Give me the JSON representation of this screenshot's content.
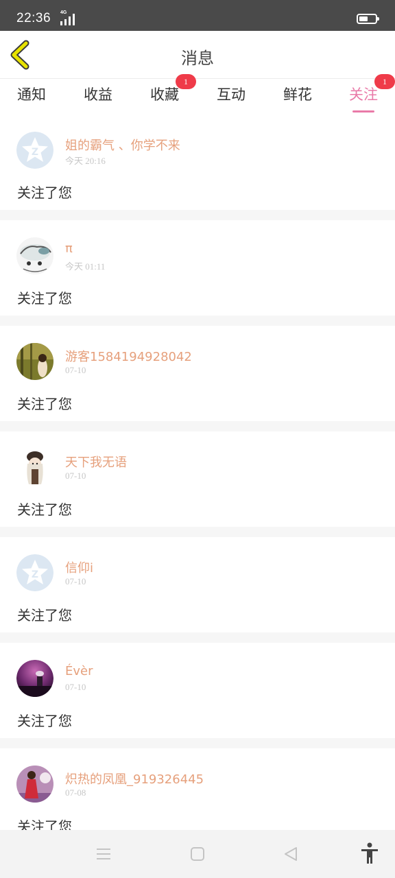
{
  "status_bar": {
    "time": "22:36",
    "network": "4G",
    "battery_percent": 55
  },
  "header": {
    "title": "消息",
    "back_icon": "chevron-left-icon"
  },
  "tabs": [
    {
      "label": "通知",
      "badge": ""
    },
    {
      "label": "收益",
      "badge": ""
    },
    {
      "label": "收藏",
      "badge": "1"
    },
    {
      "label": "互动",
      "badge": ""
    },
    {
      "label": "鲜花",
      "badge": ""
    },
    {
      "label": "关注",
      "badge": "1",
      "active": true
    }
  ],
  "messages": [
    {
      "name": "姐的霸气 、你学不来",
      "time": "今天 20:16",
      "text": "关注了您",
      "avatar": "default-avatar-icon"
    },
    {
      "name": "π",
      "time": "今天 01:11",
      "text": "关注了您",
      "avatar": "sketch-avatar"
    },
    {
      "name": "游客1584194928042",
      "time": "07-10",
      "text": "关注了您",
      "avatar": "forest-girl-avatar"
    },
    {
      "name": "天下我无语",
      "time": "07-10",
      "text": "关注了您",
      "avatar": "anime-girl-avatar"
    },
    {
      "name": "信仰i",
      "time": "07-10",
      "text": "关注了您",
      "avatar": "default-avatar-icon"
    },
    {
      "name": "Évèr",
      "time": "07-10",
      "text": "关注了您",
      "avatar": "purple-night-avatar"
    },
    {
      "name": "炽热的凤凰_919326445",
      "time": "07-08",
      "text": "关注了您",
      "avatar": "red-dress-avatar"
    }
  ],
  "nav_bar": {
    "menu_icon": "menu-icon",
    "home_icon": "home-square-icon",
    "back_icon": "back-triangle-icon",
    "accessibility_icon": "accessibility-icon"
  },
  "colors": {
    "accent": "#e97aa8",
    "name": "#e6a07c",
    "badge": "#ef3b49",
    "back_arrow": "#e7e200"
  }
}
